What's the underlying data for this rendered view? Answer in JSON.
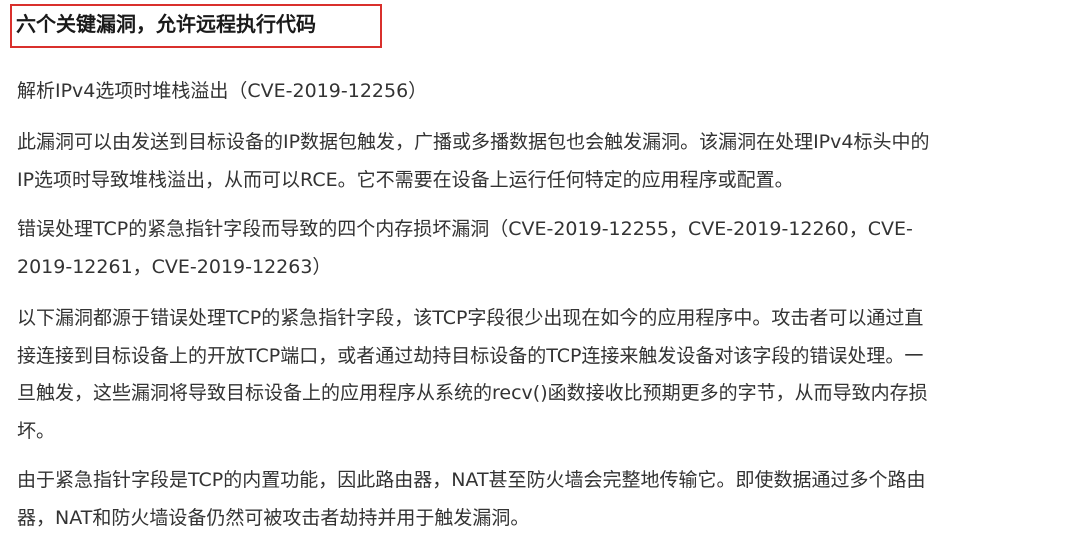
{
  "section_heading": "六个关键漏洞，允许远程执行代码",
  "paragraphs": [
    {
      "lines": [
        "解析IPv4选项时堆栈溢出（CVE-2019-12256）"
      ]
    },
    {
      "lines": [
        "此漏洞可以由发送到目标设备的IP数据包触发，广播或多播数据包也会触发漏洞。该漏洞在处理IPv4标头中的",
        "IP选项时导致堆栈溢出，从而可以RCE。它不需要在设备上运行任何特定的应用程序或配置。"
      ]
    },
    {
      "lines": [
        "错误处理TCP的紧急指针字段而导致的四个内存损坏漏洞（CVE-2019-12255，CVE-2019-12260，CVE-",
        "2019-12261，CVE-2019-12263）"
      ]
    },
    {
      "lines": [
        "以下漏洞都源于错误处理TCP的紧急指针字段，该TCP字段很少出现在如今的应用程序中。攻击者可以通过直",
        "接连接到目标设备上的开放TCP端口，或者通过劫持目标设备的TCP连接来触发设备对该字段的错误处理。一",
        "旦触发，这些漏洞将导致目标设备上的应用程序从系统的recv()函数接收比预期更多的字节，从而导致内存损",
        "坏。"
      ]
    },
    {
      "lines": [
        "由于紧急指针字段是TCP的内置功能，因此路由器，NAT甚至防火墙会完整地传输它。即使数据通过多个路由",
        "器，NAT和防火墙设备仍然可被攻击者劫持并用于触发漏洞。"
      ]
    }
  ],
  "colors": {
    "highlight_border": "#d9302c",
    "text": "#333333",
    "heading_text": "#1a1a1a",
    "background": "#ffffff"
  }
}
